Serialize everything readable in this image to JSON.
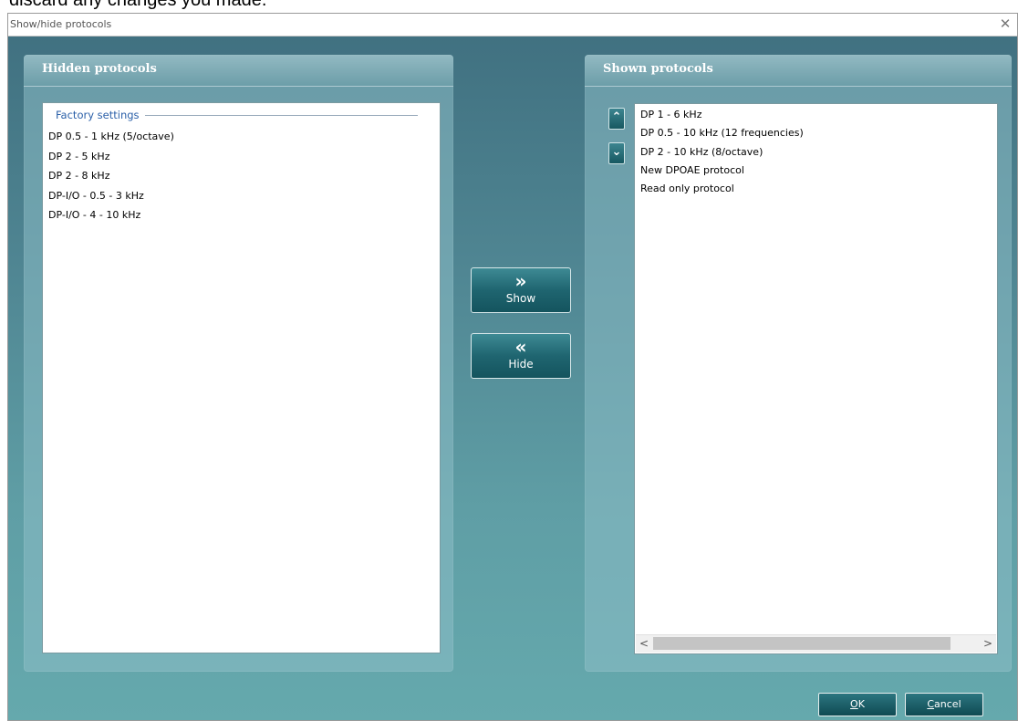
{
  "caption": "discard any changes you made.",
  "dialog": {
    "title": "Show/hide protocols",
    "close_glyph": "✕"
  },
  "hidden_panel": {
    "header": "Hidden protocols",
    "group_label": "Factory settings",
    "items": [
      "DP 0.5 - 1 kHz (5/octave)",
      "DP 2 - 5 kHz",
      "DP 2 - 8 kHz",
      "DP-I/O - 0.5 - 3 kHz",
      "DP-I/O - 4 - 10 kHz"
    ]
  },
  "shown_panel": {
    "header": "Shown protocols",
    "items": [
      "DP 1 - 6 kHz",
      "DP 0.5 - 10 kHz (12 frequencies)",
      "DP 2 - 10 kHz (8/octave)",
      "New DPOAE protocol",
      "Read only protocol"
    ],
    "move_up_glyph": "⌃",
    "move_down_glyph": "⌄",
    "scroll_left_glyph": "<",
    "scroll_right_glyph": ">"
  },
  "actions": {
    "show": {
      "glyph": "»",
      "label": "Show"
    },
    "hide": {
      "glyph": "«",
      "label": "Hide"
    }
  },
  "footer": {
    "ok_mnemonic": "O",
    "ok_rest": "K",
    "cancel_mnemonic": "C",
    "cancel_rest": "ancel"
  },
  "colors": {
    "background_top": "#3f6f7f",
    "background_bottom": "#65a9ad",
    "button_dark": "#14545e",
    "group_label": "#2a5fa8"
  }
}
